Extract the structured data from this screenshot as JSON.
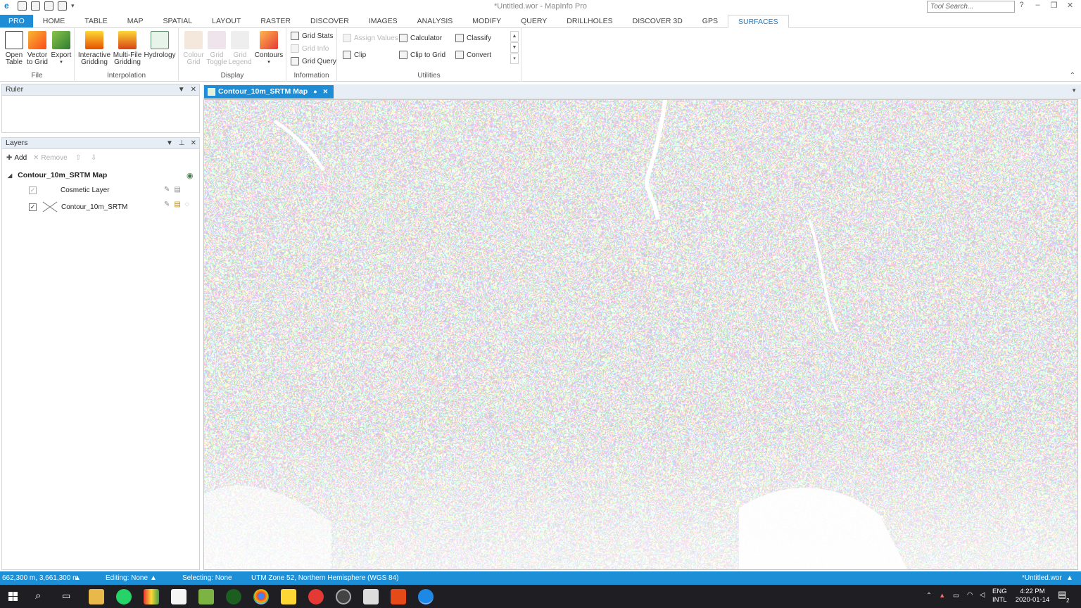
{
  "window": {
    "title": "*Untitled.wor - MapInfo Pro",
    "search_placeholder": "Tool Search...",
    "controls": [
      "?",
      "–",
      "❐",
      "✕"
    ]
  },
  "ribbon": {
    "tabs": [
      "PRO",
      "HOME",
      "TABLE",
      "MAP",
      "SPATIAL",
      "LAYOUT",
      "RASTER",
      "DISCOVER",
      "IMAGES",
      "ANALYSIS",
      "MODIFY",
      "QUERY",
      "DRILLHOLES",
      "DISCOVER 3D",
      "GPS",
      "SURFACES"
    ],
    "active_tab": "SURFACES",
    "groups": {
      "file": {
        "label": "File",
        "open_table": [
          "Open",
          "Table"
        ],
        "vector_to_grid": [
          "Vector",
          "to Grid"
        ],
        "export": "Export"
      },
      "interpolation": {
        "label": "Interpolation",
        "interactive": [
          "Interactive",
          "Gridding"
        ],
        "multifile": [
          "Multi-File",
          "Gridding"
        ],
        "hydrology": "Hydrology"
      },
      "display": {
        "label": "Display",
        "colour_grid": [
          "Colour",
          "Grid"
        ],
        "grid_toggle": [
          "Grid",
          "Toggle"
        ],
        "grid_legend": [
          "Grid",
          "Legend"
        ],
        "contours": "Contours"
      },
      "information": {
        "label": "Information",
        "grid_stats": "Grid Stats",
        "grid_info": "Grid Info",
        "grid_query": "Grid Query"
      },
      "utilities": {
        "label": "Utilities",
        "assign_values": "Assign Values",
        "clip": "Clip",
        "calculator": "Calculator",
        "clip_to_grid": "Clip to Grid",
        "classify": "Classify",
        "convert": "Convert"
      }
    }
  },
  "panels": {
    "ruler": {
      "title": "Ruler"
    },
    "layers": {
      "title": "Layers",
      "add": "Add",
      "remove": "Remove",
      "map_name": "Contour_10m_SRTM Map",
      "items": [
        {
          "name": "Cosmetic Layer",
          "checked": true
        },
        {
          "name": "Contour_10m_SRTM",
          "checked": true
        }
      ]
    }
  },
  "document": {
    "tab_title": "Contour_10m_SRTM Map"
  },
  "status": {
    "coords": "662,300 m, 3,661,300 m",
    "editing": "Editing: None",
    "selecting": "Selecting: None",
    "projection": "UTM Zone 52, Northern Hemisphere (WGS 84)",
    "workspace": "*Untitled.wor"
  },
  "taskbar": {
    "lang": "ENG",
    "layout": "INTL",
    "time": "4:22 PM",
    "date": "2020-01-14",
    "notifications": "2"
  }
}
